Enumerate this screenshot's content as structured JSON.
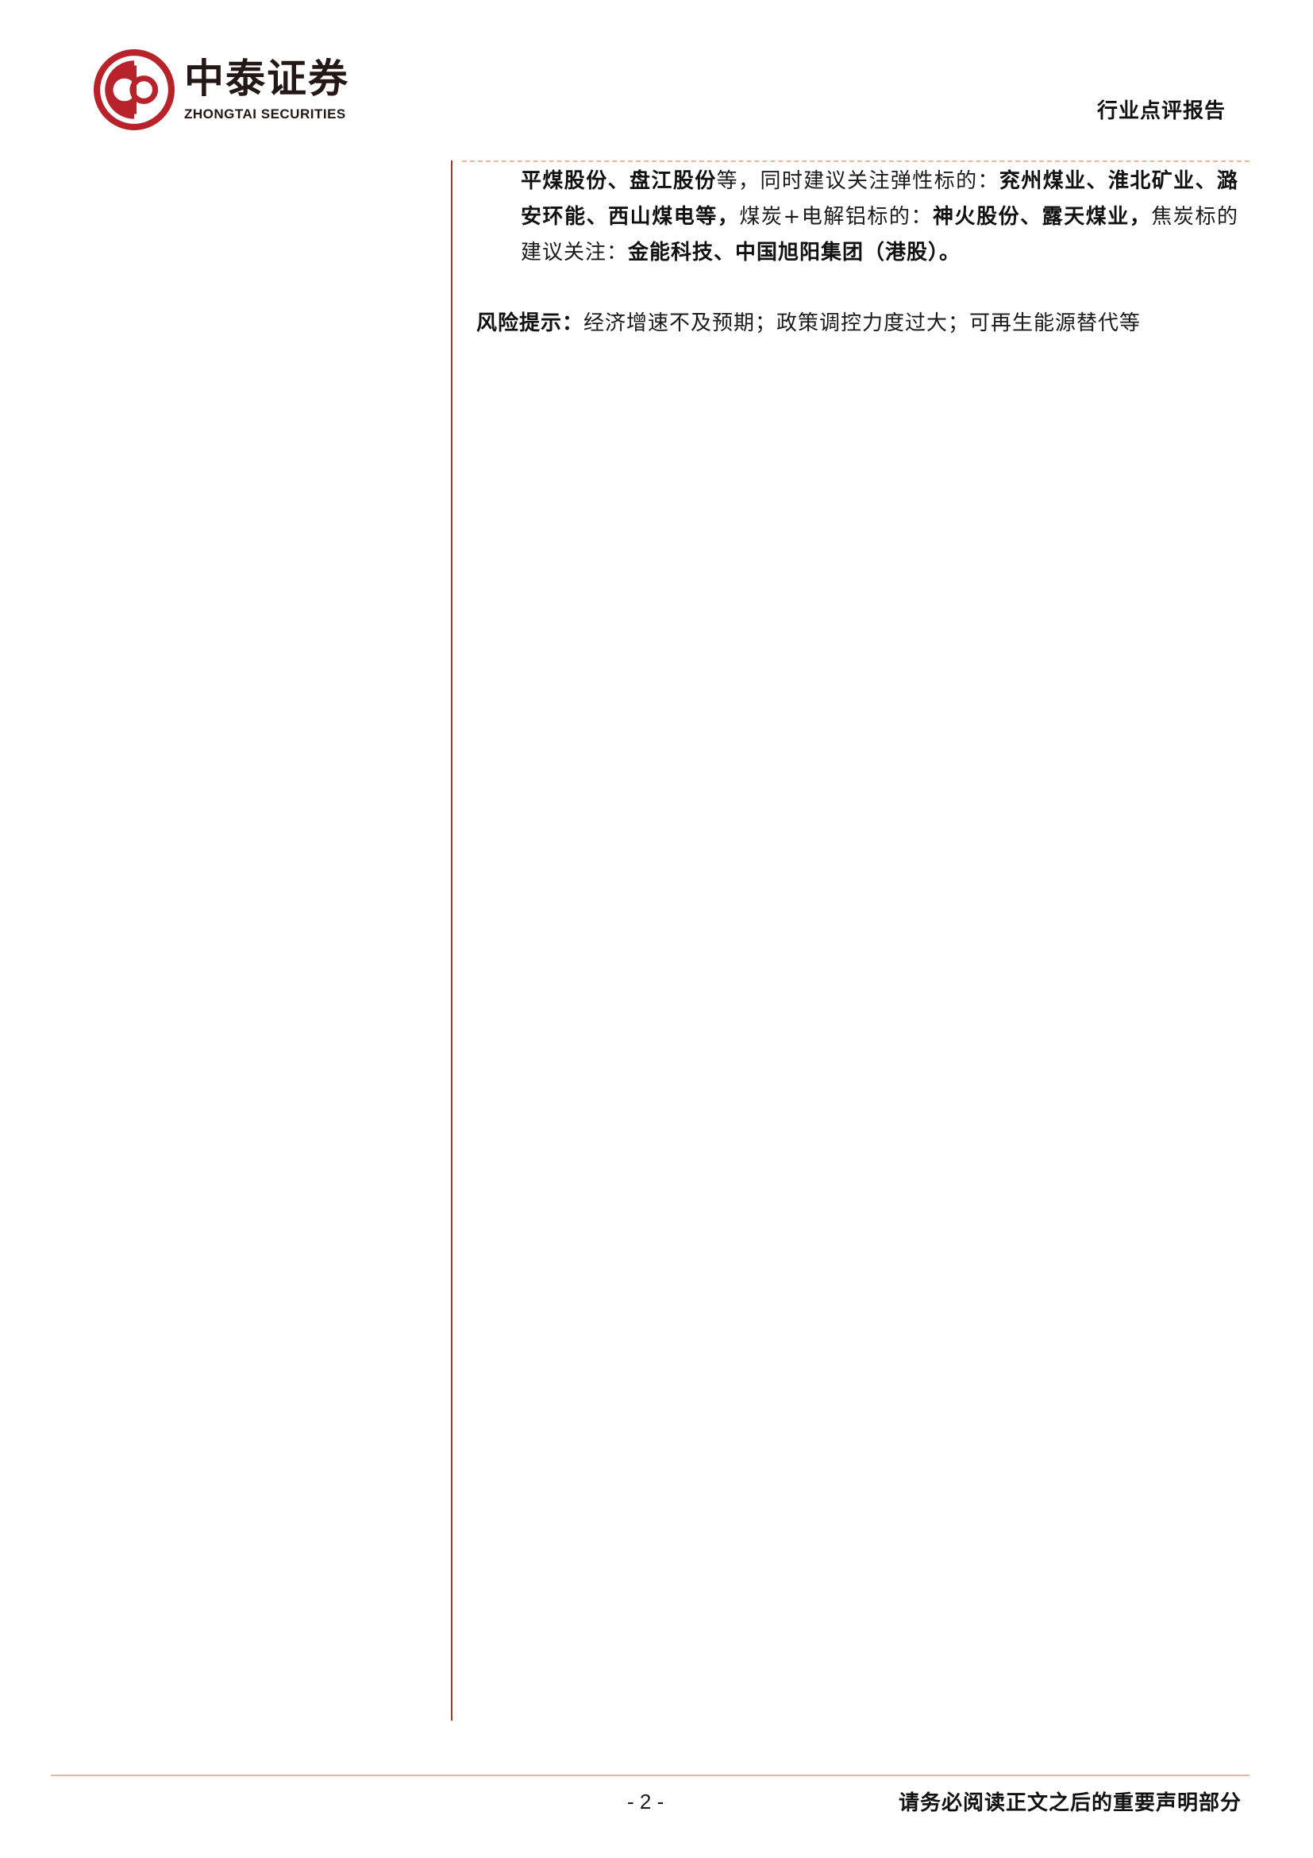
{
  "brand": {
    "name_cn": "中泰证券",
    "name_en": "ZHONGTAI SECURITIES",
    "logo_color": "#b8232b",
    "logo_icon": "zhongtai-logo-icon"
  },
  "header": {
    "report_type": "行业点评报告"
  },
  "content": {
    "paragraph": {
      "s1_bold": "平煤股份、盘江股份",
      "s2": "等，同时建议关注弹性标的：",
      "s3_bold": "兖州煤业、淮北矿业、潞安环能、西山煤电等，",
      "s4": "煤炭+电解铝标的：",
      "s5_bold": "神火股份、露天煤业，",
      "s6": "焦炭标的建议关注：",
      "s7_bold": "金能科技、中国旭阳集团（港股）。"
    },
    "risk": {
      "label": "风险提示：",
      "text": "经济增速不及预期；政策调控力度过大；可再生能源替代等"
    }
  },
  "footer": {
    "page_number": "- 2 -",
    "disclaimer": "请务必阅读正文之后的重要声明部分"
  },
  "colors": {
    "rule_accent": "#e6b89c",
    "left_rule": "#9a3a30"
  }
}
